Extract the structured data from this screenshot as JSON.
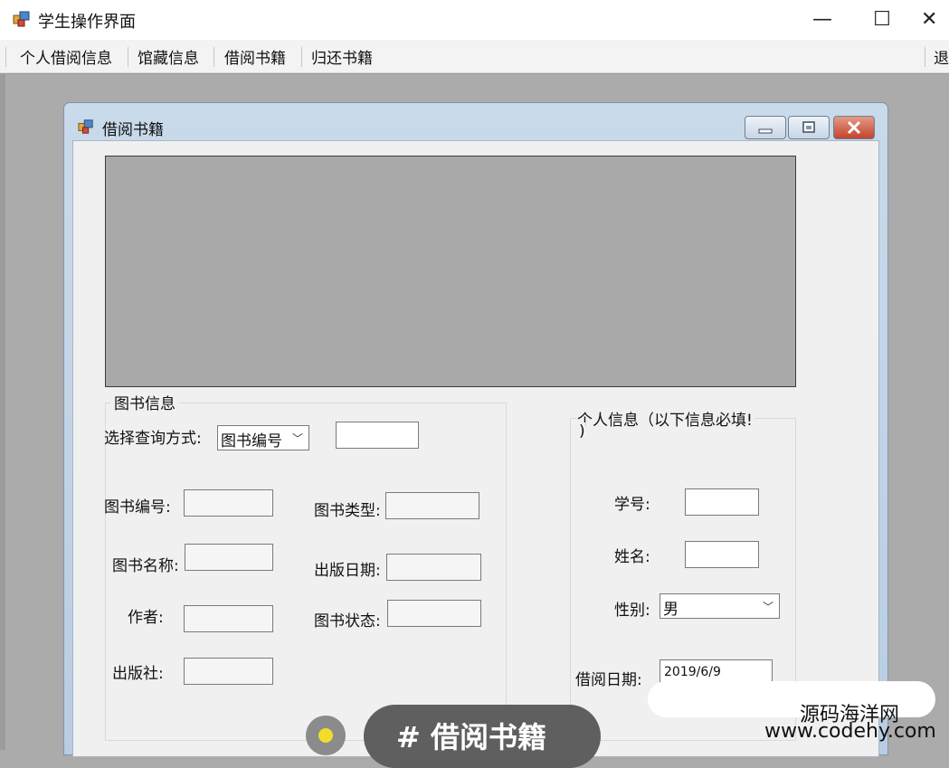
{
  "window": {
    "title": "学生操作界面",
    "minimize_glyph": "—",
    "maximize_glyph": "☐",
    "close_glyph": "✕"
  },
  "menu": {
    "items": [
      "个人借阅信息",
      "馆藏信息",
      "借阅书籍",
      "归还书籍"
    ],
    "exit_label": "退"
  },
  "child_window": {
    "title": "借阅书籍"
  },
  "book_info": {
    "group_title": "图书信息",
    "query_label": "选择查询方式:",
    "query_mode": "图书编号",
    "query_value": "",
    "fields": {
      "book_id_label": "图书编号:",
      "book_type_label": "图书类型:",
      "book_name_label": "图书名称:",
      "publish_date_label": "出版日期:",
      "author_label": "作者:",
      "book_status_label": "图书状态:",
      "publisher_label": "出版社:"
    }
  },
  "personal_info": {
    "group_title_line1": "个人信息（以下信息必填!",
    "group_title_line2": ")",
    "student_id_label": "学号:",
    "name_label": "姓名:",
    "gender_label": "性别:",
    "gender_value": "男",
    "borrow_date_label": "借阅日期:",
    "borrow_date_value": "2019/6/9"
  },
  "overlay": {
    "tag_text": "# 借阅书籍",
    "watermark_line1": "源码海洋网",
    "watermark_line2": "www.codehy.com"
  },
  "colors": {
    "grid_bg": "#a9a9a9",
    "mdi_bg": "#ababab",
    "child_title_gradient_top": "#c9daea",
    "close_button_red": "#c3442b",
    "tag_pill": "#5f5f5f",
    "dot": "#f2dd2b"
  },
  "icons": {
    "app": "app-window-icon",
    "combo": "chevron-down-icon"
  }
}
